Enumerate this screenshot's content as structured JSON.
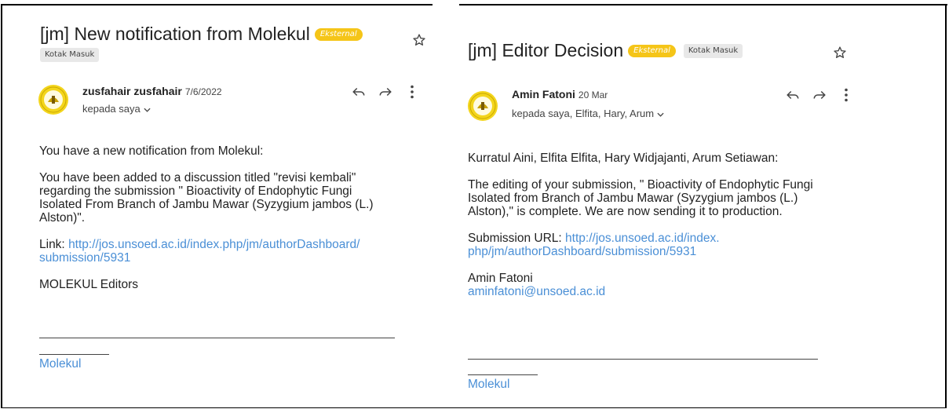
{
  "left_email": {
    "subject": "[jm] New notification from Molekul",
    "external_badge": "Eksternal",
    "inbox_label": "Kotak Masuk",
    "sender_name": "zusfahair zusfahair",
    "date": "7/6/2022",
    "recipients": "kepada saya",
    "body": {
      "intro": "You have a new notification from Molekul:",
      "message_l1": "You have been added to a discussion titled \"revisi kembali\"",
      "message_l2": "regarding the submission \" Bioactivity of Endophytic Fungi",
      "message_l3": "Isolated From Branch of Jambu Mawar (Syzygium jambos (L.)",
      "message_l4": "Alston)\".",
      "link_prefix": "Link: ",
      "link_l1": "http://jos.unsoed.ac.id/index.php/jm/authorDashboard/",
      "link_l2": "submission/5931",
      "closing": "MOLEKUL Editors",
      "footer_link": "Molekul"
    }
  },
  "right_email": {
    "subject": "[jm] Editor Decision",
    "external_badge": "Eksternal",
    "inbox_label": "Kotak Masuk",
    "sender_name": "Amin Fatoni",
    "date": "20 Mar",
    "recipients": "kepada saya, Elfita, Hary, Arum",
    "body": {
      "greeting": "Kurratul Aini, Elfita Elfita, Hary Widjajanti, Arum Setiawan:",
      "message_l1": "The editing of your submission, \" Bioactivity of Endophytic Fungi",
      "message_l2": "Isolated from Branch of Jambu Mawar (Syzygium jambos (L.)",
      "message_l3": "Alston),\" is complete. We are now sending it to production.",
      "url_prefix": "Submission URL: ",
      "url_l1": "http://jos.unsoed.ac.id/index.",
      "url_l2": "php/jm/authorDashboard/submission/5931",
      "signer_name": "Amin Fatoni",
      "signer_email": "aminfatoni@unsoed.ac.id",
      "footer_link": "Molekul"
    }
  },
  "colors": {
    "badge": "#f5c518",
    "link": "#4a8fd6",
    "chip": "#e8e8e8"
  },
  "icons": [
    "star-icon",
    "reply-icon",
    "forward-icon",
    "more-vert-icon",
    "chevron-down-icon"
  ]
}
